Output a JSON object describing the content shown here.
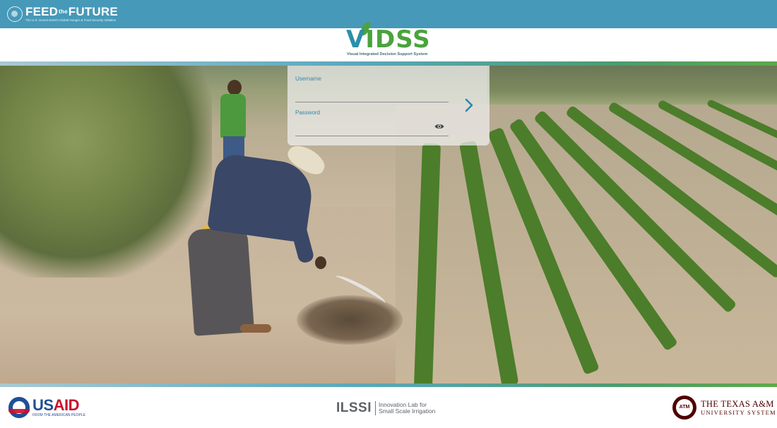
{
  "header": {
    "feed_the_future": {
      "title_left": "FEED",
      "title_mid": "the",
      "title_right": "FUTURE",
      "subtitle": "The U.S. Government's Global Hunger & Food Security Initiative"
    },
    "app_logo": {
      "v": "V",
      "rest": "IDSS",
      "subtitle": "Visual Integrated Decision Support System"
    }
  },
  "login": {
    "username_label": "Username",
    "username_value": "",
    "password_label": "Password",
    "password_value": ""
  },
  "footer": {
    "usaid": {
      "word_us": "US",
      "word_aid": "AID",
      "tagline": "FROM THE AMERICAN PEOPLE"
    },
    "ilssi": {
      "word": "ILSSI",
      "desc_line1": "Innovation Lab for",
      "desc_line2": "Small Scale Irrigation"
    },
    "tamu": {
      "line1": "THE TEXAS A&M",
      "line2": "UNIVERSITY SYSTEM"
    }
  },
  "colors": {
    "topbar": "#4699b8",
    "label": "#3a86aa",
    "usaid_blue": "#1f4f96",
    "usaid_red": "#c8102e",
    "tamu_maroon": "#500000"
  },
  "icons": {
    "submit": "chevron-right-icon",
    "password_toggle": "eye-icon"
  }
}
